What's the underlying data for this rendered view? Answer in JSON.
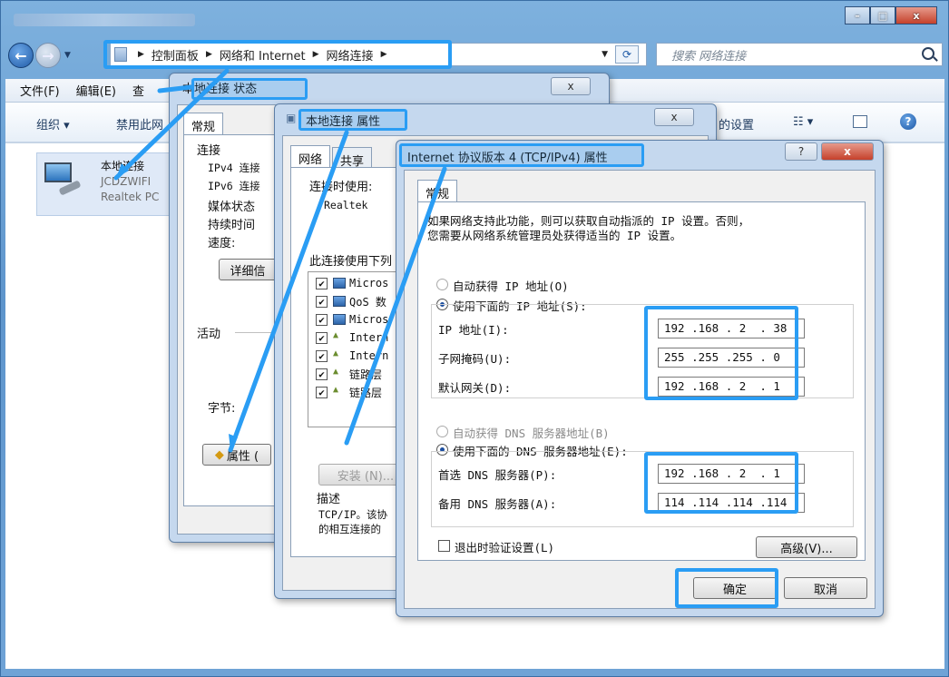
{
  "window": {
    "minimize_glyph": "–",
    "maximize_glyph": "□",
    "close_glyph": "x"
  },
  "address": {
    "segments": [
      "控制面板",
      "网络和 Internet",
      "网络连接"
    ],
    "search_placeholder": "搜索 网络连接"
  },
  "menubar": {
    "items": [
      "文件(F)",
      "编辑(E)",
      "查"
    ]
  },
  "toolbar": {
    "organize": "组织 ▾",
    "disable": "禁用此网",
    "settings_partial": "的设置",
    "view_glyph": "☷ ▾"
  },
  "adapter": {
    "name": "本地连接",
    "ssid": "JCDZWIFI",
    "driver": "Realtek PC"
  },
  "status_dialog": {
    "title": "本地连接 状态",
    "tab": "常规",
    "section_connection": "连接",
    "rows": [
      "IPv4 连接",
      "IPv6 连接",
      "媒体状态",
      "持续时间",
      "速度:"
    ],
    "details_button": "详细信",
    "section_activity": "活动",
    "bytes_label": "字节:",
    "properties_button": "属性 (",
    "close_glyph": "x"
  },
  "props_dialog": {
    "title": "本地连接 属性",
    "tabs": [
      "网络",
      "共享"
    ],
    "connect_using": "连接时使用:",
    "adapter_short": "Realtek",
    "items_label": "此连接使用下列",
    "list": [
      "Micros",
      "QoS 数",
      "Micros",
      "Intern",
      "Intern",
      "链路层",
      "链路层"
    ],
    "install_button": "安装 (N)...",
    "desc_label": "描述",
    "desc_line1": "TCP/IP。该协",
    "desc_line2": "的相互连接的",
    "close_glyph": "x"
  },
  "ipv4_dialog": {
    "title": "Internet 协议版本 4 (TCP/IPv4) 属性",
    "help_glyph": "?",
    "close_glyph": "x",
    "tab": "常规",
    "intro_line1": "如果网络支持此功能，则可以获取自动指派的 IP 设置。否则，",
    "intro_line2": "您需要从网络系统管理员处获得适当的 IP 设置。",
    "auto_ip": "自动获得 IP 地址(O)",
    "manual_ip": "使用下面的 IP 地址(S):",
    "ip_label": "IP 地址(I):",
    "mask_label": "子网掩码(U):",
    "gateway_label": "默认网关(D):",
    "ip_value": "192 .168 . 2  . 38",
    "mask_value": "255 .255 .255 . 0",
    "gateway_value": "192 .168 . 2  . 1",
    "auto_dns": "自动获得 DNS 服务器地址(B)",
    "manual_dns": "使用下面的 DNS 服务器地址(E):",
    "dns1_label": "首选 DNS 服务器(P):",
    "dns2_label": "备用 DNS 服务器(A):",
    "dns1_value": "192 .168 . 2  . 1",
    "dns2_value": "114 .114 .114 .114",
    "validate_label": "退出时验证设置(L)",
    "advanced_button": "高级(V)...",
    "ok_button": "确定",
    "cancel_button": "取消"
  },
  "colors": {
    "highlight": "#2a9df4",
    "titlebar": "#6fa3d6",
    "dialog_frame": "#c5d8ee"
  }
}
